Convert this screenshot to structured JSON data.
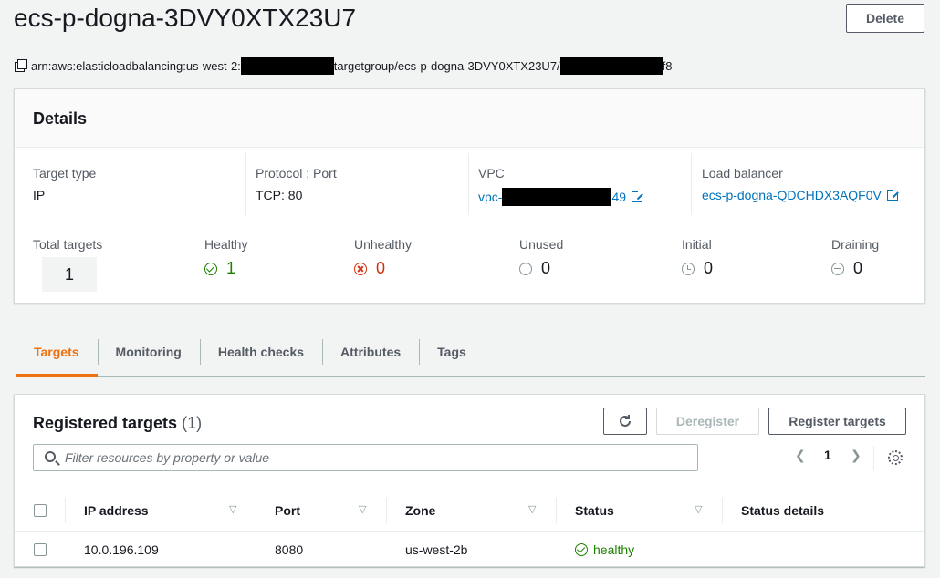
{
  "page": {
    "title": "ecs-p-dogna-3DVY0XTX23U7",
    "delete_label": "Delete",
    "arn_prefix": "arn:aws:elasticloadbalancing:us-west-2:",
    "arn_middle": "targetgroup/ecs-p-dogna-3DVY0XTX23U7/",
    "arn_suffix": "f8"
  },
  "details": {
    "heading": "Details",
    "attributes": [
      {
        "label": "Target type",
        "value": "IP"
      },
      {
        "label": "Protocol : Port",
        "value": "TCP: 80"
      },
      {
        "label": "VPC",
        "value_prefix": "vpc-",
        "value_suffix": "49"
      },
      {
        "label": "Load balancer",
        "value": "ecs-p-dogna-QDCHDX3AQF0V"
      }
    ],
    "counts": [
      {
        "label": "Total targets",
        "value": "1"
      },
      {
        "label": "Healthy",
        "value": "1"
      },
      {
        "label": "Unhealthy",
        "value": "0"
      },
      {
        "label": "Unused",
        "value": "0"
      },
      {
        "label": "Initial",
        "value": "0"
      },
      {
        "label": "Draining",
        "value": "0"
      }
    ]
  },
  "tabs": [
    "Targets",
    "Monitoring",
    "Health checks",
    "Attributes",
    "Tags"
  ],
  "targets": {
    "title": "Registered targets",
    "count": "(1)",
    "deregister_label": "Deregister",
    "register_label": "Register targets",
    "filter_placeholder": "Filter resources by property or value",
    "page_number": "1",
    "columns": [
      "IP address",
      "Port",
      "Zone",
      "Status",
      "Status details"
    ],
    "rows": [
      {
        "ip": "10.0.196.109",
        "port": "8080",
        "zone": "us-west-2b",
        "status": "healthy",
        "status_details": ""
      }
    ]
  },
  "colors": {
    "accent": "#ec7211",
    "link": "#0073bb",
    "healthy": "#1d8102",
    "unhealthy": "#d13212"
  }
}
